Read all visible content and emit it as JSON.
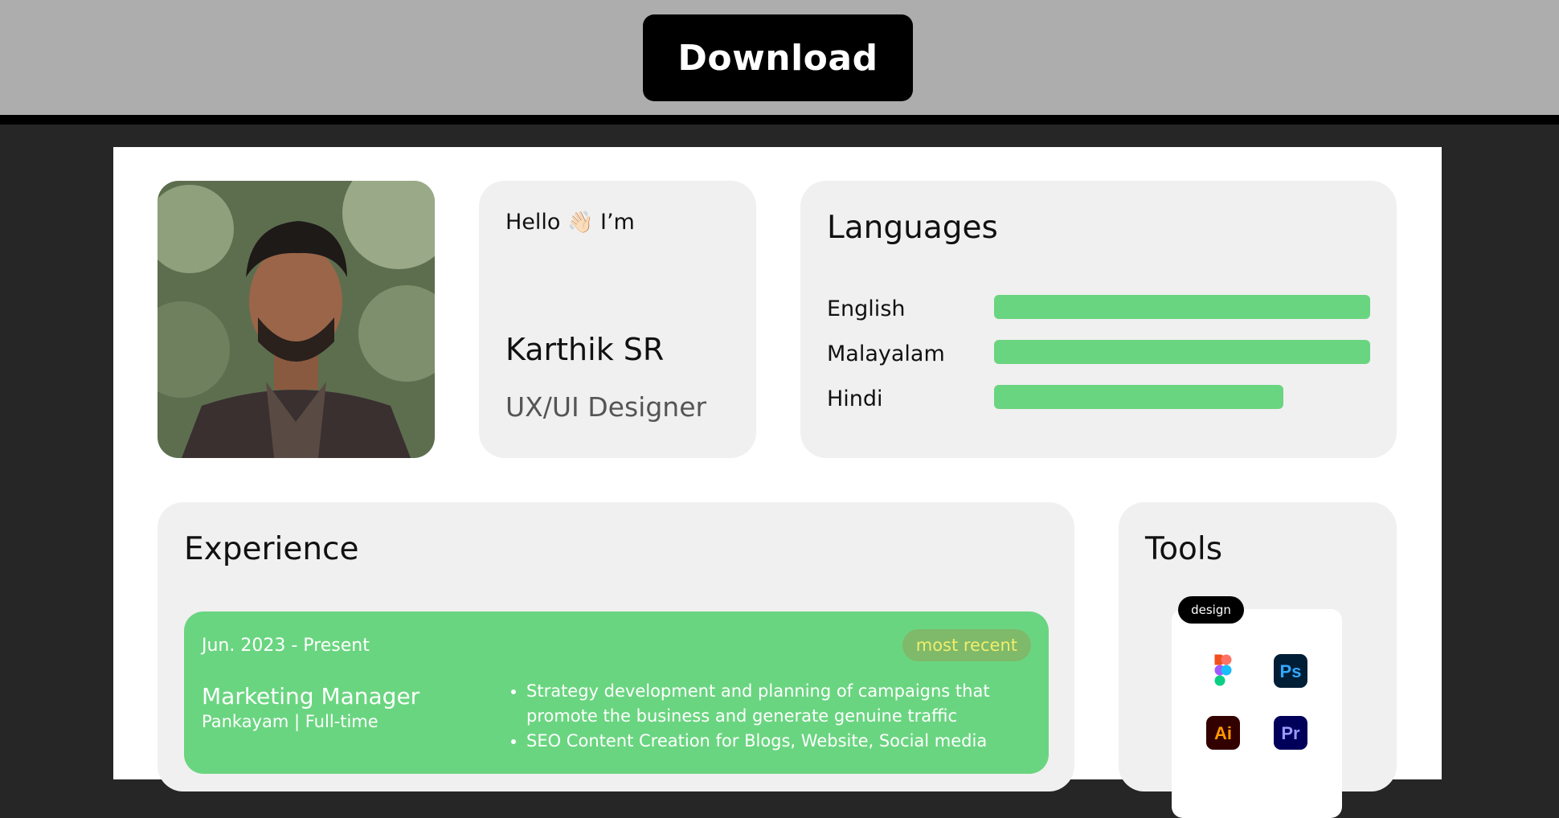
{
  "toolbar": {
    "download_label": "Download"
  },
  "intro": {
    "greeting": "Hello",
    "wave_emoji": "👋🏻",
    "greeting_suffix": "I’m",
    "name": "Karthik SR",
    "role": "UX/UI Designer"
  },
  "languages": {
    "title": "Languages",
    "items": [
      {
        "name": "English",
        "level": 1.0
      },
      {
        "name": "Malayalam",
        "level": 1.0
      },
      {
        "name": "Hindi",
        "level": 0.77
      }
    ]
  },
  "experience": {
    "title": "Experience",
    "jobs": [
      {
        "dates": "Jun. 2023 - Present",
        "badge": "most recent",
        "title": "Marketing Manager",
        "company": "Pankayam  |  Full-time",
        "bullets": [
          "Strategy development and planning of campaigns that promote the business and generate genuine traffic",
          "SEO Content Creation for Blogs, Website, Social media"
        ]
      }
    ]
  },
  "tools": {
    "title": "Tools",
    "category": "design",
    "items": [
      {
        "icon": "figma-icon"
      },
      {
        "icon": "photoshop-icon",
        "label": "Ps",
        "bg": "#001e36",
        "fg": "#31a8ff"
      },
      {
        "icon": "illustrator-icon",
        "label": "Ai",
        "bg": "#330000",
        "fg": "#ff9a00"
      },
      {
        "icon": "premiere-icon",
        "label": "Pr",
        "bg": "#00005b",
        "fg": "#9999ff"
      }
    ]
  },
  "colors": {
    "accent_green": "#6ad580",
    "badge_text": "#f0ee6a",
    "card_bg": "#f0f0f0",
    "header_bg": "#adadad"
  }
}
